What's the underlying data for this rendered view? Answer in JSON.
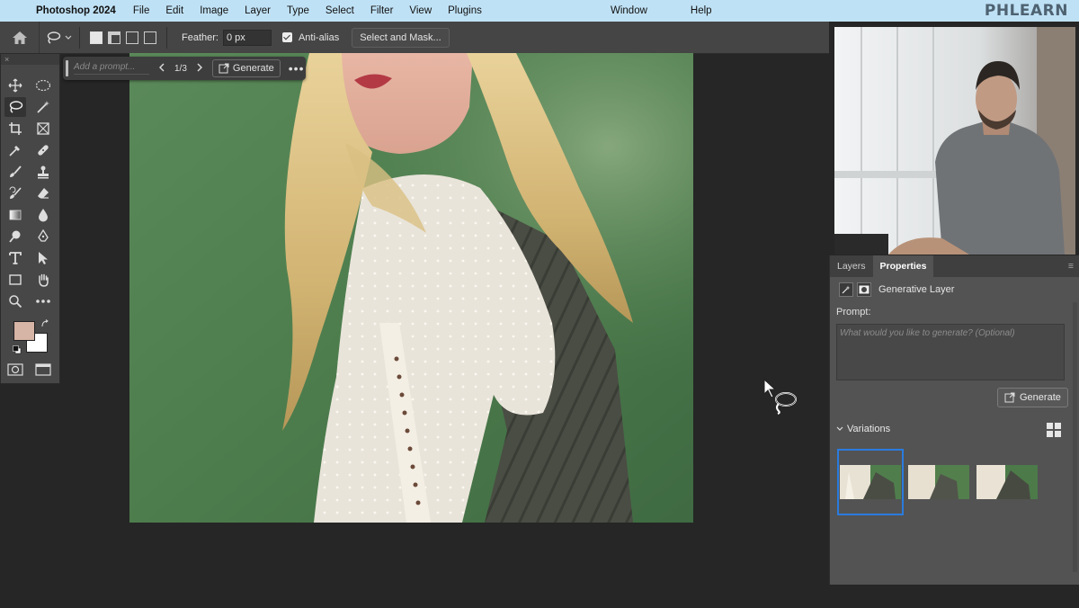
{
  "menubar": {
    "app_name": "Photoshop 2024",
    "items": [
      "File",
      "Edit",
      "Image",
      "Layer",
      "Type",
      "Select",
      "Filter",
      "View",
      "Plugins"
    ],
    "right_items": [
      "Window",
      "Help"
    ],
    "brand": "PHLEARN"
  },
  "options_bar": {
    "feather_label": "Feather:",
    "feather_value": "0 px",
    "anti_alias_label": "Anti-alias",
    "anti_alias_checked": true,
    "select_and_mask_label": "Select and Mask..."
  },
  "context_bar": {
    "prompt_placeholder": "Add a prompt...",
    "counter": "1/3",
    "generate_label": "Generate"
  },
  "panel": {
    "tabs": [
      "Layers",
      "Properties"
    ],
    "active_tab": "Properties",
    "layer_type": "Generative Layer",
    "prompt_label": "Prompt:",
    "prompt_placeholder": "What would you like to generate? (Optional)",
    "generate_label": "Generate",
    "variations_label": "Variations",
    "variations_count": 3,
    "selected_variation": 1
  },
  "colors": {
    "menubar_bg": "#bfe1f5",
    "accent": "#2a7bde",
    "foreground_color": "#d6b4a6",
    "background_color": "#ffffff"
  }
}
